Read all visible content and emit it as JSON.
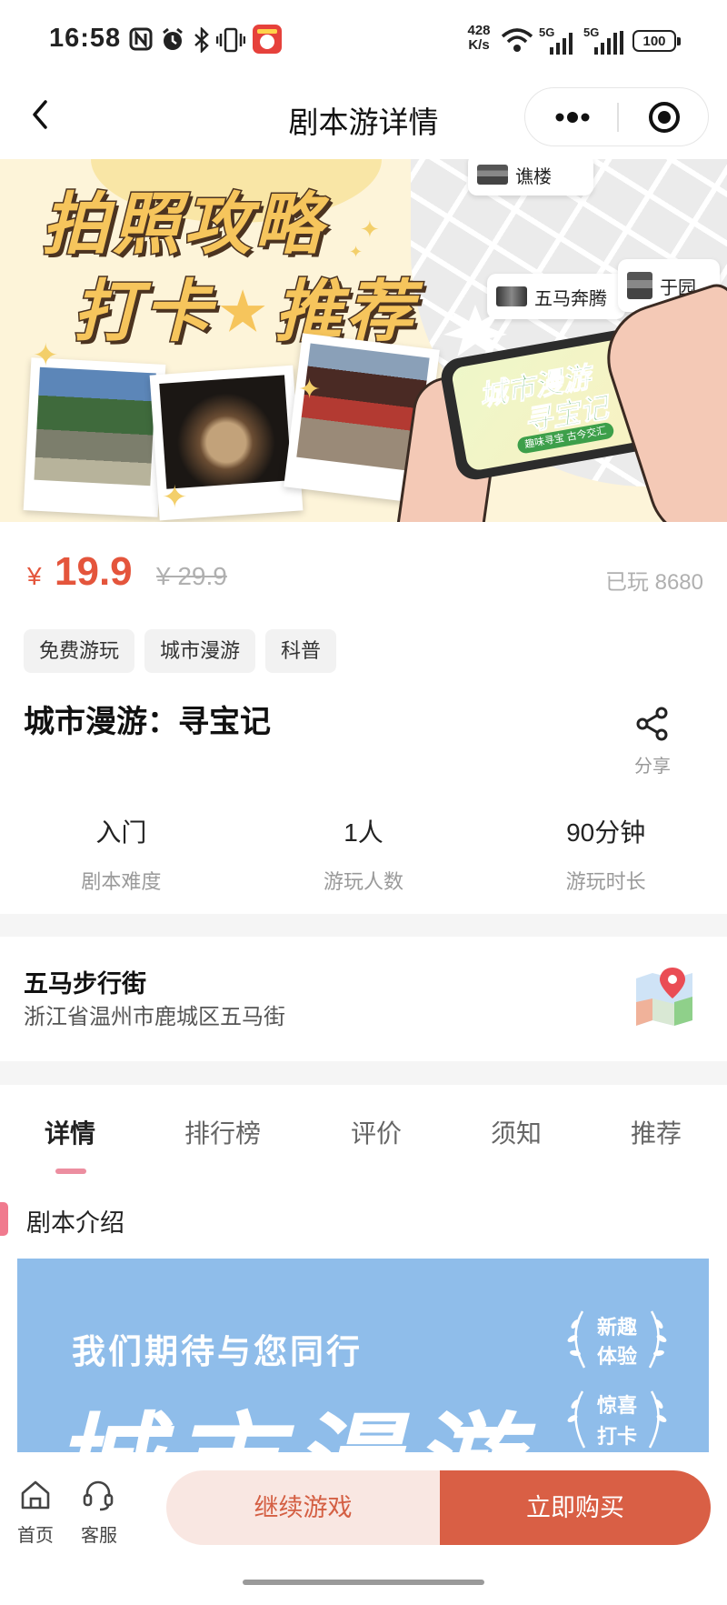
{
  "status_bar": {
    "time": "16:58",
    "net_speed": "428",
    "net_unit": "K/s",
    "sim1_label": "5G",
    "sim2_label": "5G",
    "battery": "100",
    "icons": [
      "nfc-icon",
      "alarm-icon",
      "bluetooth-icon",
      "vibrate-icon",
      "app-notification-icon",
      "wifi-icon",
      "signal-icon",
      "battery-icon"
    ]
  },
  "header": {
    "title": "剧本游详情",
    "icons": [
      "chevron-left-icon",
      "more-dots-icon",
      "target-icon"
    ]
  },
  "banner": {
    "headline_1": "拍照攻略",
    "headline_2a": "打卡",
    "headline_2b": "推荐",
    "map_labels": [
      "谯楼",
      "五马奔腾",
      "于园"
    ],
    "phone_title_1": "城市漫游",
    "phone_title_2": "寻宝记",
    "phone_subtitle": "趣味寻宝 古今交汇"
  },
  "price": {
    "currency": "¥",
    "current": "19.9",
    "original": "¥ 29.9",
    "played": "已玩 8680"
  },
  "tags": [
    "免费游玩",
    "城市漫游",
    "科普"
  ],
  "title": "城市漫游：寻宝记",
  "share_label": "分享",
  "stats": [
    {
      "value": "入门",
      "label": "剧本难度"
    },
    {
      "value": "1人",
      "label": "游玩人数"
    },
    {
      "value": "90分钟",
      "label": "游玩时长"
    }
  ],
  "location": {
    "name": "五马步行街",
    "address": "浙江省温州市鹿城区五马街"
  },
  "tabs": [
    "详情",
    "排行榜",
    "评价",
    "须知",
    "推荐"
  ],
  "active_tab": "详情",
  "section_heading": "剧本介绍",
  "intro_image": {
    "tagline": "我们期待与您同行",
    "big_title": "城市漫游",
    "badge_1": [
      "新趣",
      "体验"
    ],
    "badge_2": [
      "惊喜",
      "打卡"
    ]
  },
  "bottom_bar": {
    "home": "首页",
    "service": "客服",
    "continue": "继续游戏",
    "buy": "立即购买"
  },
  "colors": {
    "accent": "#e4553c",
    "buy_button": "#d95f45",
    "continue_bg": "#f9e7e2",
    "continue_text": "#d45f43",
    "tab_indicator": "#ec8ea0",
    "section_bar": "#f07a8e",
    "intro_bg": "#8fbdea"
  }
}
